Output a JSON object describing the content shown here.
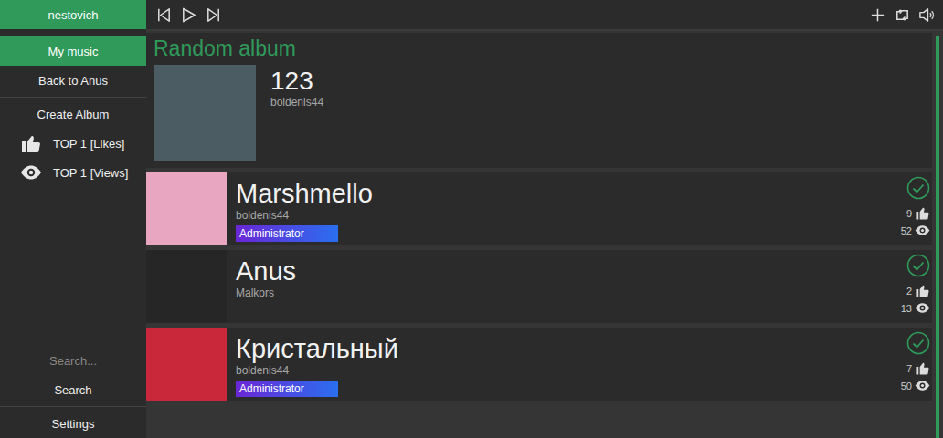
{
  "user": {
    "name": "nestovich"
  },
  "sidebar": {
    "items": [
      {
        "label": "My music",
        "selected": true,
        "kind": "plain"
      },
      {
        "label": "Back to Anus",
        "selected": false,
        "kind": "plain"
      },
      {
        "label": "Create Album",
        "selected": false,
        "kind": "plain"
      },
      {
        "label": "TOP 1 [Likes]",
        "selected": false,
        "kind": "likes"
      },
      {
        "label": "TOP 1 [Views]",
        "selected": false,
        "kind": "views"
      }
    ]
  },
  "search": {
    "placeholder": "Search...",
    "button": "Search"
  },
  "settings": "Settings",
  "player": {
    "now_playing": "–"
  },
  "random_album": {
    "heading": "Random album",
    "title": "123",
    "author": "boldenis44",
    "color": "#4b5c63"
  },
  "albums": [
    {
      "title": "Marshmello",
      "author": "boldenis44",
      "badge": "Administrator",
      "likes": "9",
      "views": "52",
      "added": true,
      "color": "#e9a6c0"
    },
    {
      "title": "Anus",
      "author": "Malkors",
      "badge": null,
      "likes": "2",
      "views": "13",
      "added": true,
      "color": "#262626"
    },
    {
      "title": "Кристальный",
      "author": "boldenis44",
      "badge": "Administrator",
      "likes": "7",
      "views": "50",
      "added": true,
      "color": "#c9283a"
    }
  ]
}
